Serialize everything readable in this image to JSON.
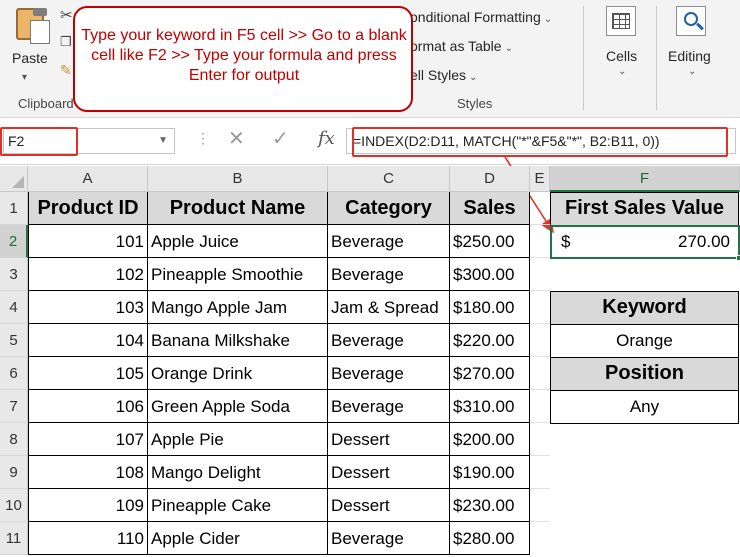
{
  "ribbon": {
    "paste_label": "Paste",
    "clipboard_label": "Clipboard",
    "conditional_formatting": "onditional Formatting",
    "format_as_table": "ormat as Table",
    "cell_styles": "ell Styles",
    "styles_label": "Styles",
    "cells_label": "Cells",
    "editing_label": "Editing",
    "icons": [
      "paste-icon",
      "cut-icon",
      "copy-icon",
      "format-painter-icon",
      "cells-icon",
      "search-icon"
    ]
  },
  "callout": {
    "text": "Type your keyword in F5 cell >> Go to a blank cell like F2 >> Type your formula and press Enter for output",
    "color": "#c00000"
  },
  "formula_bar": {
    "name_box": "F2",
    "cancel_symbol": "✕",
    "enter_symbol": "✓",
    "fx_label": "fx",
    "formula": "=INDEX(D2:D11, MATCH(\"*\"&F5&\"*\", B2:B11, 0))"
  },
  "columns": [
    "A",
    "B",
    "C",
    "D",
    "E",
    "F"
  ],
  "rows": [
    "1",
    "2",
    "3",
    "4",
    "5",
    "6",
    "7",
    "8",
    "9",
    "10",
    "11"
  ],
  "table": {
    "headers": [
      "Product ID",
      "Product Name",
      "Category",
      "Sales"
    ],
    "rows": [
      [
        "101",
        "Apple Juice",
        "Beverage",
        "$250.00"
      ],
      [
        "102",
        "Pineapple Smoothie",
        "Beverage",
        "$300.00"
      ],
      [
        "103",
        "Mango Apple Jam",
        "Jam & Spread",
        "$180.00"
      ],
      [
        "104",
        "Banana Milkshake",
        "Beverage",
        "$220.00"
      ],
      [
        "105",
        "Orange Drink",
        "Beverage",
        "$270.00"
      ],
      [
        "106",
        "Green Apple Soda",
        "Beverage",
        "$310.00"
      ],
      [
        "107",
        "Apple Pie",
        "Dessert",
        "$200.00"
      ],
      [
        "108",
        "Mango Delight",
        "Dessert",
        "$190.00"
      ],
      [
        "109",
        "Pineapple Cake",
        "Dessert",
        "$230.00"
      ],
      [
        "110",
        "Apple Cider",
        "Beverage",
        "$280.00"
      ]
    ]
  },
  "result": {
    "header": "First Sales Value",
    "currency": "$",
    "value": "270.00"
  },
  "keyword": {
    "header": "Keyword",
    "value": "Orange"
  },
  "position": {
    "header": "Position",
    "value": "Any"
  },
  "colors": {
    "accent_green": "#217346",
    "highlight_red": "#e0302a",
    "header_fill": "#d9d9d9"
  }
}
